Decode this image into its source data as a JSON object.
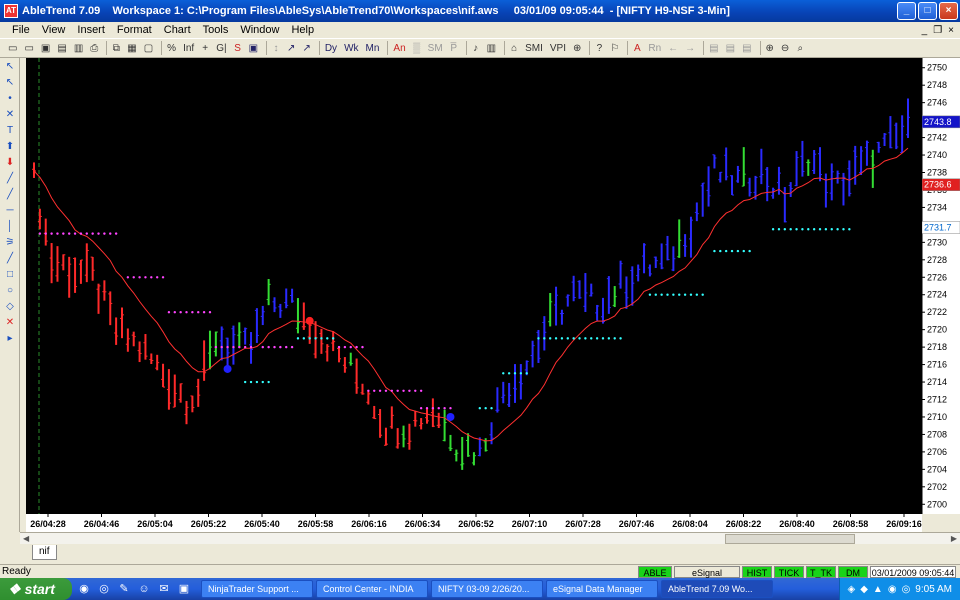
{
  "window": {
    "title": "AbleTrend 7.09    Workspace 1: C:\\Program Files\\AbleSys\\AbleTrend70\\Workspaces\\nif.aws     03/01/09 09:05:44  - [NIFTY H9-NSF 3-Min]",
    "app_icon": "AT",
    "minimize": "_",
    "maximize": "□",
    "close": "×"
  },
  "menu": {
    "items": [
      "File",
      "View",
      "Insert",
      "Format",
      "Chart",
      "Tools",
      "Window",
      "Help"
    ],
    "mdi_min": "_",
    "mdi_restore": "❐",
    "mdi_close": "×"
  },
  "toolbar": {
    "items": [
      {
        "label": "▭",
        "cls": ""
      },
      {
        "label": "▭",
        "cls": ""
      },
      {
        "label": "▣",
        "cls": ""
      },
      {
        "label": "▤",
        "cls": ""
      },
      {
        "label": "▥",
        "cls": ""
      },
      {
        "label": "⎙",
        "cls": ""
      },
      {
        "sep": true
      },
      {
        "label": "⧉",
        "cls": ""
      },
      {
        "label": "▦",
        "cls": ""
      },
      {
        "label": "▢",
        "cls": ""
      },
      {
        "sep": true
      },
      {
        "label": "%",
        "cls": ""
      },
      {
        "label": "Inf",
        "cls": ""
      },
      {
        "label": "+",
        "cls": ""
      },
      {
        "label": "G|",
        "cls": ""
      },
      {
        "label": "S",
        "cls": "red"
      },
      {
        "label": "▣",
        "cls": "blue"
      },
      {
        "sep": true
      },
      {
        "label": "↕",
        "cls": "grey"
      },
      {
        "label": "↗",
        "cls": "blue"
      },
      {
        "label": "↗",
        "cls": "blue"
      },
      {
        "sep": true
      },
      {
        "label": "Dy",
        "cls": "blue"
      },
      {
        "label": "Wk",
        "cls": "blue"
      },
      {
        "label": "Mn",
        "cls": "blue"
      },
      {
        "sep": true
      },
      {
        "label": "An",
        "cls": "red"
      },
      {
        "label": "▒",
        "cls": "grey"
      },
      {
        "label": "SM",
        "cls": "grey"
      },
      {
        "label": "P̅",
        "cls": "grey"
      },
      {
        "sep": true
      },
      {
        "label": "♪",
        "cls": ""
      },
      {
        "label": "▥",
        "cls": ""
      },
      {
        "sep": true
      },
      {
        "label": "⌂",
        "cls": ""
      },
      {
        "label": "SMI",
        "cls": ""
      },
      {
        "label": "VPI",
        "cls": ""
      },
      {
        "label": "⊕",
        "cls": ""
      },
      {
        "sep": true
      },
      {
        "label": "?",
        "cls": ""
      },
      {
        "label": "⚐",
        "cls": ""
      },
      {
        "sep": true
      },
      {
        "label": "A",
        "cls": "red"
      },
      {
        "label": "Rn",
        "cls": "grey"
      },
      {
        "label": "←",
        "cls": "grey"
      },
      {
        "label": "→",
        "cls": "grey"
      },
      {
        "sep": true
      },
      {
        "label": "▤",
        "cls": "grey"
      },
      {
        "label": "▤",
        "cls": "grey"
      },
      {
        "label": "▤",
        "cls": "grey"
      },
      {
        "sep": true
      },
      {
        "label": "⊕",
        "cls": ""
      },
      {
        "label": "⊖",
        "cls": ""
      },
      {
        "label": "⌕",
        "cls": ""
      }
    ]
  },
  "left_tools": [
    {
      "label": "↖",
      "icon": "select-arrow-icon"
    },
    {
      "label": "↖",
      "icon": "pointer-icon"
    },
    {
      "label": "•",
      "icon": "dot-icon"
    },
    {
      "label": "✕",
      "icon": "cross-icon"
    },
    {
      "label": "T",
      "icon": "text-icon"
    },
    {
      "label": "⬆",
      "icon": "up-arrow-icon"
    },
    {
      "label": "⬇",
      "icon": "down-arrow-icon",
      "red": true
    },
    {
      "label": "╱",
      "icon": "trendline-icon"
    },
    {
      "label": "╱",
      "icon": "ray-icon"
    },
    {
      "label": "─",
      "icon": "horizontal-line-icon"
    },
    {
      "label": "│",
      "icon": "vertical-line-icon"
    },
    {
      "label": "⚞",
      "icon": "fibonacci-icon"
    },
    {
      "label": "╱",
      "icon": "channel-icon"
    },
    {
      "label": "□",
      "icon": "rectangle-icon"
    },
    {
      "label": "○",
      "icon": "ellipse-icon"
    },
    {
      "label": "◇",
      "icon": "eraser-icon"
    },
    {
      "label": "✕",
      "icon": "delete-icon",
      "red": true
    },
    {
      "label": "▸",
      "icon": "more-tools-icon"
    }
  ],
  "chart_data": {
    "type": "ohlc-bar",
    "symbol_window": "NIFTY H9-NSF 3-Min",
    "ylim": [
      2699,
      2751
    ],
    "y_ticks": [
      2750,
      2748,
      2746,
      2744,
      2742,
      2740,
      2738,
      2736,
      2734,
      2732,
      2730,
      2728,
      2726,
      2724,
      2722,
      2720,
      2718,
      2716,
      2714,
      2712,
      2710,
      2708,
      2706,
      2704,
      2702,
      2700
    ],
    "x_ticks": [
      "26/04:28",
      "26/04:46",
      "26/05:04",
      "26/05:22",
      "26/05:40",
      "26/05:58",
      "26/06:16",
      "26/06:34",
      "26/06:52",
      "26/07:10",
      "26/07:28",
      "26/07:46",
      "26/08:04",
      "26/08:22",
      "26/08:40",
      "26/08:58",
      "26/09:16"
    ],
    "bar_count": 150,
    "colors": {
      "up": "#ff2a2a",
      "neutral": "#33dd33",
      "down": "#2a2aff",
      "ma": "#ff3030",
      "stop_magenta": "#ff44ff",
      "stop_cyan": "#33ffff",
      "signal_blue": "#2020ff",
      "signal_red": "#ff2020"
    },
    "price_labels": [
      {
        "value": 2743.8,
        "text": "2743.8",
        "bg": "#1414c8",
        "fg": "#ffffff"
      },
      {
        "value": 2736.6,
        "text": "2736.6",
        "bg": "#e02020",
        "fg": "#ffffff"
      },
      {
        "value": 2731.7,
        "text": "2731.7",
        "bg": "#ffffff",
        "fg": "#0066cc"
      }
    ],
    "signals": [
      {
        "bar": 33,
        "value": 2715.5,
        "color": "blue"
      },
      {
        "bar": 47,
        "value": 2721,
        "color": "red"
      },
      {
        "bar": 71,
        "value": 2710,
        "color": "blue"
      }
    ]
  },
  "tabs": {
    "active": "nif"
  },
  "status": {
    "ready": "Ready",
    "indicators": [
      {
        "label": "ABLE",
        "cls": "green",
        "w": 34
      },
      {
        "label": "eSignal",
        "cls": "grey",
        "w": 66
      },
      {
        "label": "HIST",
        "cls": "green",
        "w": 30
      },
      {
        "label": "TICK",
        "cls": "green",
        "w": 30
      },
      {
        "label": "T_TK",
        "cls": "green",
        "w": 30
      },
      {
        "label": "DM",
        "cls": "green",
        "w": 30
      },
      {
        "label": "03/01/2009 09:05:44",
        "cls": "white",
        "w": 86
      }
    ]
  },
  "taskbar": {
    "start": "start",
    "quicklaunch": [
      "◉",
      "◎",
      "✎",
      "☺",
      "✉",
      "▣"
    ],
    "tasks": [
      {
        "label": "NinjaTrader Support ...",
        "w": 112,
        "active": false
      },
      {
        "label": "Control Center - INDIA",
        "w": 112,
        "active": false
      },
      {
        "label": "NIFTY 03-09  2/26/20...",
        "w": 112,
        "active": false
      },
      {
        "label": "eSignal Data Manager",
        "w": 112,
        "active": false
      },
      {
        "label": "AbleTrend 7.09      Wo...",
        "w": 112,
        "active": true
      }
    ],
    "tray_icons": [
      "◈",
      "◆",
      "▲",
      "◉",
      "◎"
    ],
    "clock": "9:05 AM"
  }
}
